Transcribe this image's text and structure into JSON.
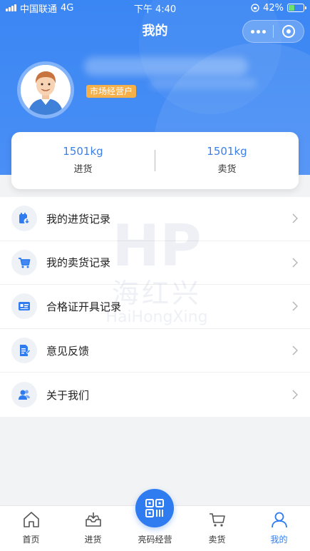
{
  "status_bar": {
    "carrier": "中国联通",
    "network": "4G",
    "time": "下午 4:40",
    "battery": "42%",
    "battery_level": 0.42
  },
  "nav": {
    "title": "我的"
  },
  "profile": {
    "role_badge": "市场经营户"
  },
  "stats": [
    {
      "value": "1501kg",
      "label": "进货"
    },
    {
      "value": "1501kg",
      "label": "卖货"
    }
  ],
  "menu": [
    {
      "label": "我的进货记录",
      "icon": "purchase-record-icon"
    },
    {
      "label": "我的卖货记录",
      "icon": "sales-cart-icon"
    },
    {
      "label": "合格证开具记录",
      "icon": "certificate-icon"
    },
    {
      "label": "意见反馈",
      "icon": "feedback-icon"
    },
    {
      "label": "关于我们",
      "icon": "about-us-icon"
    }
  ],
  "watermark": {
    "cn": "海红兴",
    "en": "HaiHongXing"
  },
  "tabbar": [
    {
      "label": "首页",
      "icon": "home-icon"
    },
    {
      "label": "进货",
      "icon": "inbox-icon"
    },
    {
      "label": "亮码经营",
      "icon": "qr-code-icon"
    },
    {
      "label": "卖货",
      "icon": "cart-icon"
    },
    {
      "label": "我的",
      "icon": "user-icon",
      "active": true
    }
  ],
  "colors": {
    "primary": "#3a86f3",
    "accent_blue": "#2f7cf0",
    "badge": "#f6b04a"
  }
}
